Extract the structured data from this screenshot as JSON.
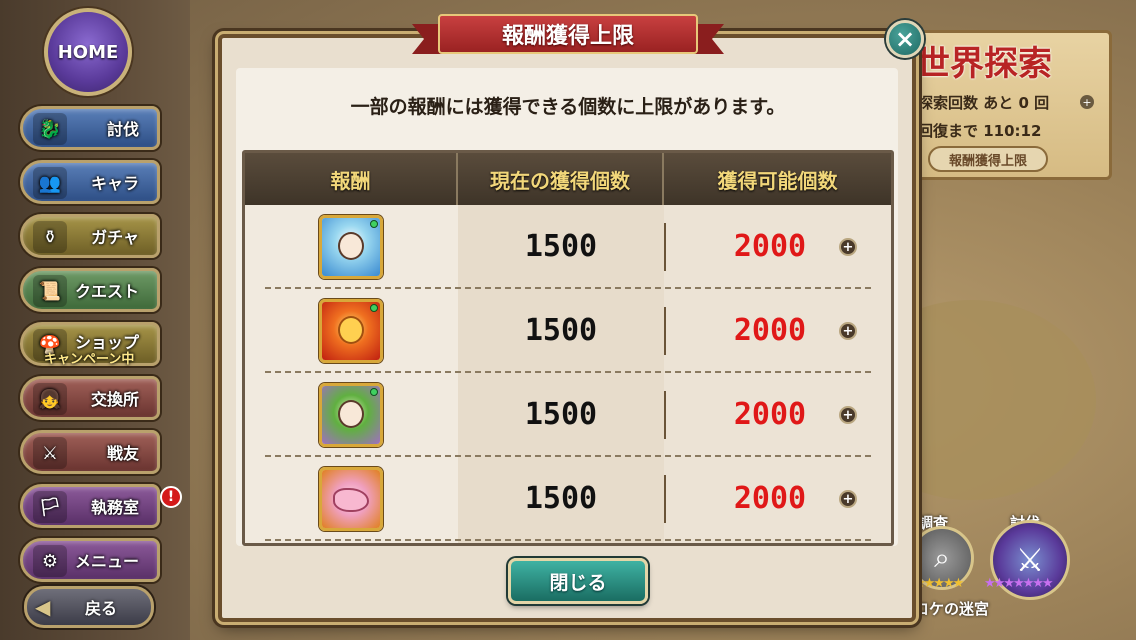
{
  "background": {
    "world_title": "世界探索",
    "explore_count_line": "探索回数 あと 0 回",
    "recovery_line": "回復まで 110:12",
    "limit_button": "報酬獲得上限",
    "survey_label": "調査",
    "subjugate_label": "討伐",
    "stars_survey": "★★★★★",
    "stars_subjugate": "★★★★★★★",
    "dungeon_name": "コケの迷宮"
  },
  "sidebar": {
    "home": "HOME",
    "items": [
      {
        "label": "討伐",
        "icon": "dragon-icon",
        "color": "blue"
      },
      {
        "label": "キャラ",
        "icon": "characters-icon",
        "color": "blue"
      },
      {
        "label": "ガチャ",
        "icon": "pot-icon",
        "color": "olive"
      },
      {
        "label": "クエスト",
        "icon": "scroll-icon",
        "color": "green"
      },
      {
        "label": "ショップ",
        "icon": "mushroom-icon",
        "color": "olive",
        "sub": "キャンペーン中"
      },
      {
        "label": "交換所",
        "icon": "girl-icon",
        "color": "red"
      },
      {
        "label": "戦友",
        "icon": "swords-icon",
        "color": "red"
      },
      {
        "label": "執務室",
        "icon": "banner-icon",
        "color": "purple",
        "alert": "!"
      },
      {
        "label": "メニュー",
        "icon": "gear-icon",
        "color": "purple"
      }
    ],
    "back": "戻る"
  },
  "dialog": {
    "title": "報酬獲得上限",
    "close_icon": "×",
    "notice": "一部の報酬には獲得できる個数に上限があります。",
    "columns": [
      "報酬",
      "現在の獲得個数",
      "獲得可能個数"
    ],
    "rows": [
      {
        "icon": "water-girl-unit-icon",
        "current": "1500",
        "max": "2000"
      },
      {
        "icon": "flower-beast-unit-icon",
        "current": "1500",
        "max": "2000"
      },
      {
        "icon": "hooded-girl-unit-icon",
        "current": "1500",
        "max": "2000"
      },
      {
        "icon": "pink-creature-unit-icon",
        "current": "1500",
        "max": "2000"
      }
    ],
    "plus_symbol": "+",
    "close_button": "閉じる"
  },
  "colors": {
    "max_value": "#e01818",
    "header_text": "#f2d77a",
    "ribbon": "#9a2222",
    "close_button": "#1a6d62"
  }
}
